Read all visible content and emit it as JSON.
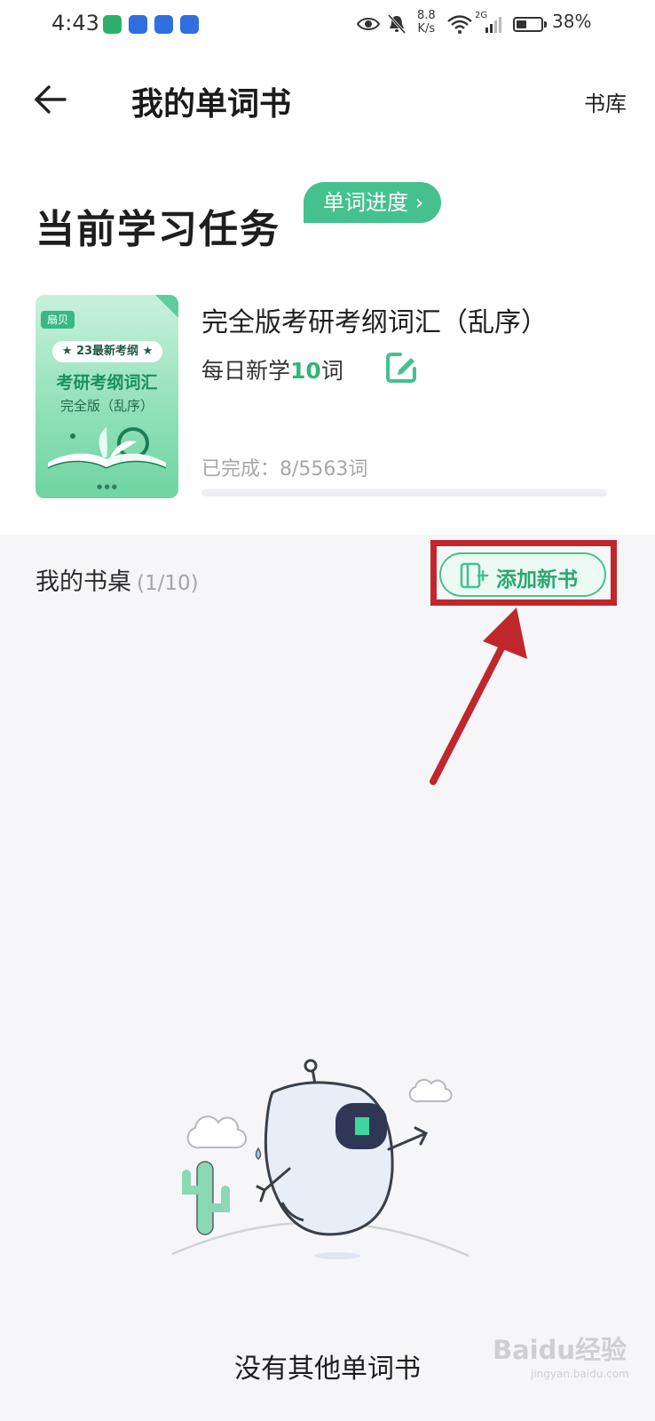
{
  "status_bar": {
    "time": "4:43",
    "net_speed_top": "8.8",
    "net_speed_bottom": "K/s",
    "signal": "2G",
    "battery": "38%",
    "battery_level": 0.38
  },
  "header": {
    "title": "我的单词书",
    "library_label": "书库"
  },
  "current_task": {
    "title": "当前学习任务",
    "progress_label": "单词进度 ›",
    "book": {
      "cover": {
        "brand": "扇贝",
        "ribbon": "★ 23最新考纲 ★",
        "title": "考研考纲词汇",
        "subtitle": "完全版（乱序）"
      },
      "title": "完全版考研考纲词汇（乱序）",
      "daily_prefix": "每日新学",
      "daily_count": "10",
      "daily_suffix": "词",
      "completed_text": "已完成：8/5563词",
      "completed_fraction": 0.0014
    }
  },
  "desk": {
    "title": "我的书桌",
    "count": "(1/10)",
    "add_button_label": "添加新书",
    "empty_text": "没有其他单词书"
  },
  "watermark": {
    "main": "Baidu经验",
    "sub": "jingyan.baidu.com"
  },
  "colors": {
    "accent": "#45c18f",
    "annotation": "#c0272d"
  }
}
